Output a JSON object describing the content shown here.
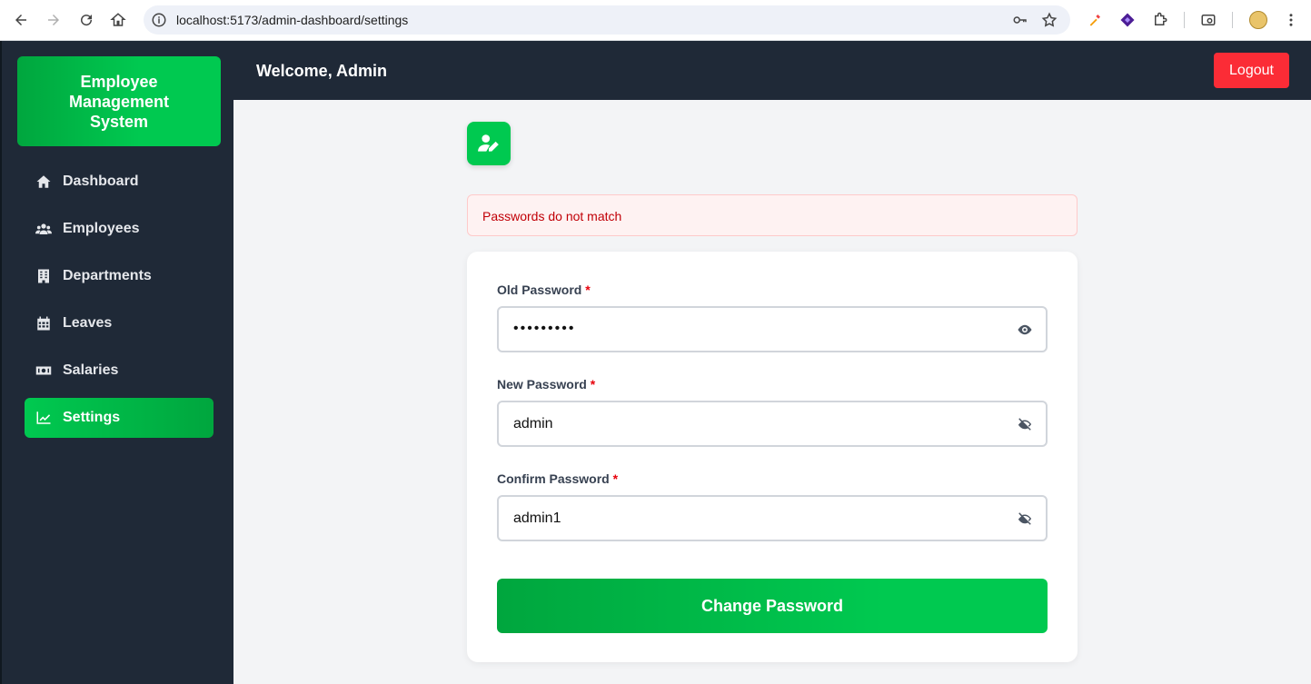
{
  "browser": {
    "url": "localhost:5173/admin-dashboard/settings"
  },
  "sidebar": {
    "brand": "Employee Management System",
    "items": [
      {
        "label": "Dashboard",
        "icon": "home-icon",
        "active": false
      },
      {
        "label": "Employees",
        "icon": "users-icon",
        "active": false
      },
      {
        "label": "Departments",
        "icon": "building-icon",
        "active": false
      },
      {
        "label": "Leaves",
        "icon": "calendar-icon",
        "active": false
      },
      {
        "label": "Salaries",
        "icon": "money-icon",
        "active": false
      },
      {
        "label": "Settings",
        "icon": "chart-line-icon",
        "active": true
      }
    ]
  },
  "header": {
    "welcome": "Welcome, Admin",
    "logout_label": "Logout"
  },
  "main": {
    "error_message": "Passwords do not match",
    "form": {
      "old_password": {
        "label": "Old Password",
        "required": "*",
        "masked_value": "•••••••••"
      },
      "new_password": {
        "label": "New Password",
        "required": "*",
        "value": "admin"
      },
      "confirm_password": {
        "label": "Confirm Password",
        "required": "*",
        "value": "admin1"
      },
      "submit_label": "Change Password"
    }
  },
  "colors": {
    "sidebar_bg": "#1f2937",
    "accent_green": "#00c950",
    "logout_red": "#fb2c36",
    "error_text": "#c10007",
    "error_bg": "#fef2f2"
  }
}
